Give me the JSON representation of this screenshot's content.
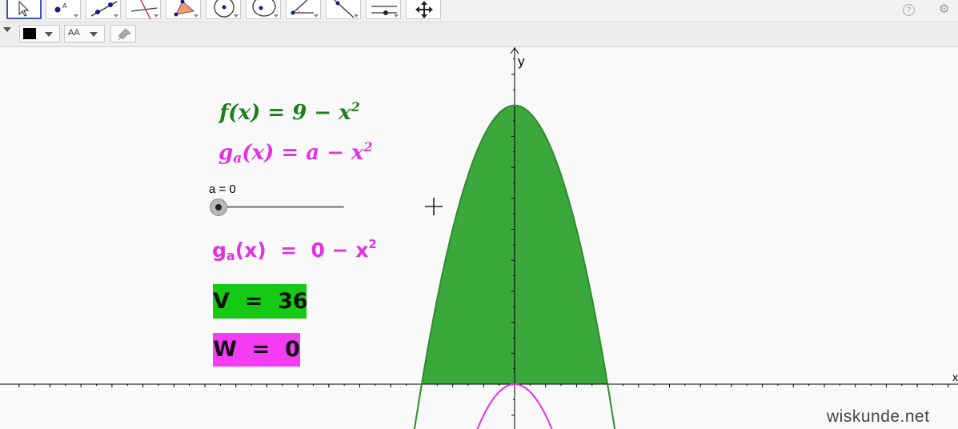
{
  "toolbar": {
    "tools": [
      {
        "name": "move-tool-icon",
        "selected": true
      },
      {
        "name": "point-tool-icon",
        "selected": false
      },
      {
        "name": "line-tool-icon",
        "selected": false
      },
      {
        "name": "perpendicular-line-tool-icon",
        "selected": false
      },
      {
        "name": "polygon-tool-icon",
        "selected": false
      },
      {
        "name": "circle-center-point-tool-icon",
        "selected": false
      },
      {
        "name": "ellipse-tool-icon",
        "selected": false
      },
      {
        "name": "angle-tool-icon",
        "selected": false
      },
      {
        "name": "reflect-tool-icon",
        "selected": false
      },
      {
        "name": "slider-tool-icon",
        "selected": false
      },
      {
        "name": "move-graphics-view-tool-icon",
        "selected": false
      }
    ],
    "help_symbol": "?",
    "gear_symbol": "⚙"
  },
  "stylebar": {
    "color_swatch": "#000000",
    "text_style_label": "AA"
  },
  "formulas": {
    "f": {
      "name": "f",
      "arg": "(x)",
      "rhs": " = 9 − x",
      "exp": "2"
    },
    "g": {
      "name": "g",
      "sub": "a",
      "arg": "(x)",
      "rhs": " = a − x",
      "exp": "2"
    }
  },
  "slider": {
    "label": "a = 0",
    "value": 0
  },
  "g_value": {
    "name": "g",
    "sub": "a",
    "rest": "(x)  =  0 − x",
    "exp": "2"
  },
  "V": {
    "label": "V  =  36",
    "color": "#15c915"
  },
  "W": {
    "label": "W  =  0",
    "color": "#f43cf4"
  },
  "axes": {
    "x_label": "x",
    "y_label": "y"
  },
  "watermark": "wiskunde.net",
  "colors": {
    "f_curve": "#2e8b2e",
    "f_fill": "#3aa83a",
    "g_curve": "#e233e2"
  }
}
